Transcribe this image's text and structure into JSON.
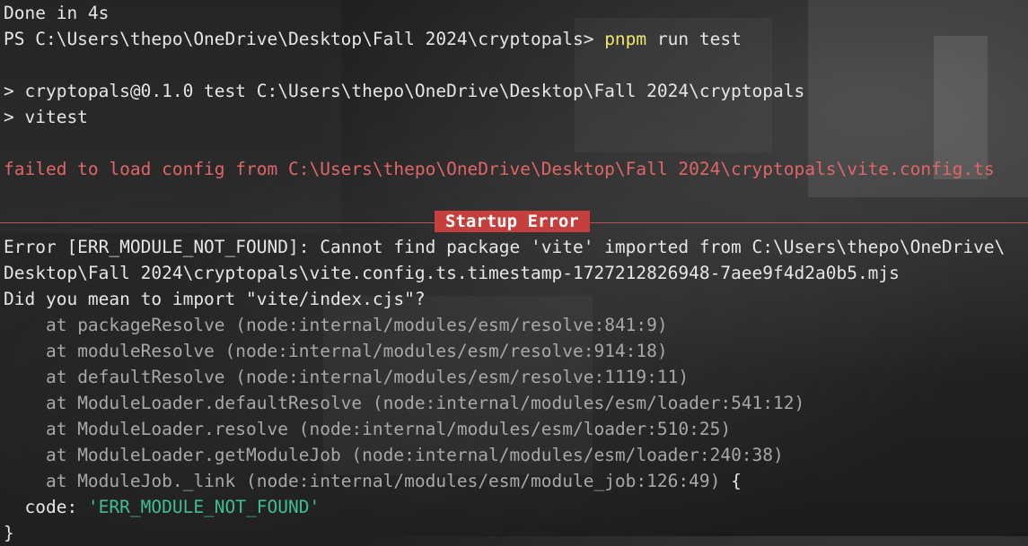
{
  "terminal": {
    "done_line": "Done in 4s",
    "prompt": "PS C:\\Users\\thepo\\OneDrive\\Desktop\\Fall 2024\\cryptopals> ",
    "command_keyword": "pnpm",
    "command_rest": " run test",
    "script_line_1": "> cryptopals@0.1.0 test C:\\Users\\thepo\\OneDrive\\Desktop\\Fall 2024\\cryptopals",
    "script_line_2": "> vitest",
    "config_error": "failed to load config from C:\\Users\\thepo\\OneDrive\\Desktop\\Fall 2024\\cryptopals\\vite.config.ts",
    "badge": "Startup Error",
    "error_line_1": "Error [ERR_MODULE_NOT_FOUND]: Cannot find package 'vite' imported from C:\\Users\\thepo\\OneDrive\\",
    "error_line_2": "Desktop\\Fall 2024\\cryptopals\\vite.config.ts.timestamp-1727212826948-7aee9f4d2a0b5.mjs",
    "error_line_3": "Did you mean to import \"vite/index.cjs\"?",
    "stack": [
      {
        "at": "    at ",
        "fn": "packageResolve",
        "loc": " (node:internal/modules/esm/resolve:841:9)",
        "tail": ""
      },
      {
        "at": "    at ",
        "fn": "moduleResolve",
        "loc": " (node:internal/modules/esm/resolve:914:18)",
        "tail": ""
      },
      {
        "at": "    at ",
        "fn": "defaultResolve",
        "loc": " (node:internal/modules/esm/resolve:1119:11)",
        "tail": ""
      },
      {
        "at": "    at ",
        "fn": "ModuleLoader.defaultResolve",
        "loc": " (node:internal/modules/esm/loader:541:12)",
        "tail": ""
      },
      {
        "at": "    at ",
        "fn": "ModuleLoader.resolve",
        "loc": " (node:internal/modules/esm/loader:510:25)",
        "tail": ""
      },
      {
        "at": "    at ",
        "fn": "ModuleLoader.getModuleJob",
        "loc": " (node:internal/modules/esm/loader:240:38)",
        "tail": ""
      },
      {
        "at": "    at ",
        "fn": "ModuleJob._link",
        "loc": " (node:internal/modules/esm/module_job:126:49)",
        "tail": " {"
      }
    ],
    "code_key": "  code: ",
    "code_value": "'ERR_MODULE_NOT_FOUND'",
    "closing_brace": "}"
  },
  "colors": {
    "command": "#f2e66b",
    "error": "#e06666",
    "badge_bg": "#c5403c",
    "string": "#3fbf8f",
    "dim": "#a8a8a8"
  }
}
